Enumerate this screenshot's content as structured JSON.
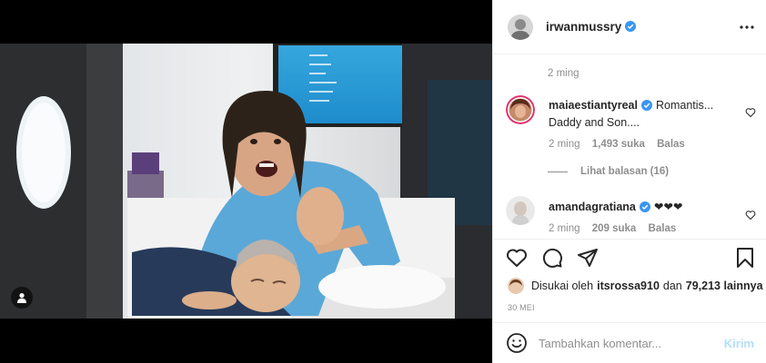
{
  "post": {
    "author": {
      "username": "irwanmussry",
      "verified": true
    },
    "more_icon": "more-horizontal-icon",
    "caption_time": "2 ming",
    "comments": [
      {
        "username": "maiaestiantyreal",
        "verified": true,
        "text_line1": "Romantis...",
        "text_line2": "Daddy and Son....",
        "time": "2 ming",
        "likes": "1,493 suka",
        "reply_label": "Balas",
        "view_replies": "Lihat balasan (16)"
      },
      {
        "username": "amandagratiana",
        "verified": true,
        "text_line1": "❤❤❤",
        "time": "2 ming",
        "likes": "209 suka",
        "reply_label": "Balas"
      }
    ],
    "actions": {
      "like_icon": "heart-icon",
      "comment_icon": "comment-icon",
      "share_icon": "send-icon",
      "save_icon": "bookmark-icon"
    },
    "liked_by": {
      "prefix": "Disukai oleh",
      "user": "itsrossa910",
      "connector": "dan",
      "others": "79,213 lainnya"
    },
    "date": "30 MEI",
    "composer": {
      "placeholder": "Tambahkan komentar...",
      "post_label": "Kirim",
      "emoji_icon": "smile-icon"
    }
  },
  "colors": {
    "verified_blue": "#3897f0",
    "text": "#262626",
    "muted": "#8e8e8e",
    "post_disabled": "#b2dffc"
  }
}
